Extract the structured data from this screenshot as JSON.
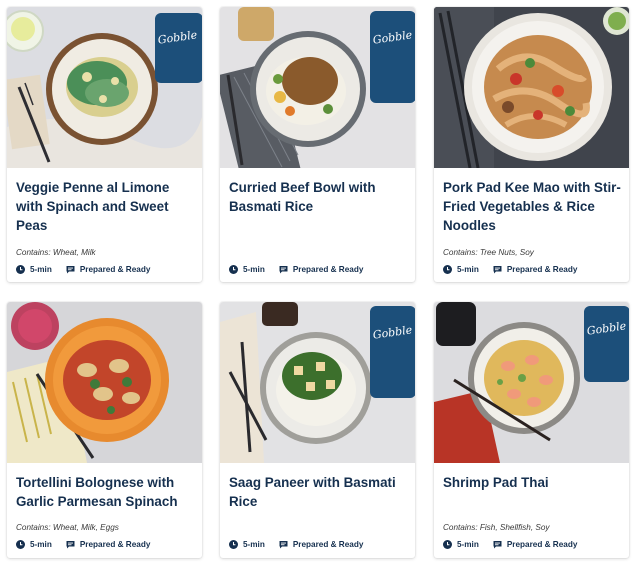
{
  "meals": [
    {
      "title": "Veggie Penne al Limone with Spinach and Sweet Peas",
      "contains": "Contains: Wheat, Milk",
      "time": "5-min",
      "prep": "Prepared & Ready",
      "package_brand": "Gobble"
    },
    {
      "title": "Curried Beef Bowl with Basmati Rice",
      "contains": "",
      "time": "5-min",
      "prep": "Prepared & Ready",
      "package_brand": "Gobble"
    },
    {
      "title": "Pork Pad Kee Mao with Stir-Fried Vegetables & Rice Noodles",
      "contains": "Contains: Tree Nuts, Soy",
      "time": "5-min",
      "prep": "Prepared & Ready"
    },
    {
      "title": "Tortellini Bolognese with Garlic Parmesan Spinach",
      "contains": "Contains: Wheat, Milk, Eggs",
      "time": "5-min",
      "prep": "Prepared & Ready"
    },
    {
      "title": "Saag Paneer with Basmati Rice",
      "contains": "",
      "time": "5-min",
      "prep": "Prepared & Ready",
      "package_brand": "Gobble"
    },
    {
      "title": "Shrimp Pad Thai",
      "contains": "Contains: Fish, Shellfish, Soy",
      "time": "5-min",
      "prep": "Prepared & Ready",
      "package_brand": "Gobble"
    }
  ],
  "icons": {
    "time": "clock-icon",
    "prep": "chat-bubble-icon"
  },
  "colors": {
    "title": "#16304f",
    "package": "#1c4f7a"
  }
}
